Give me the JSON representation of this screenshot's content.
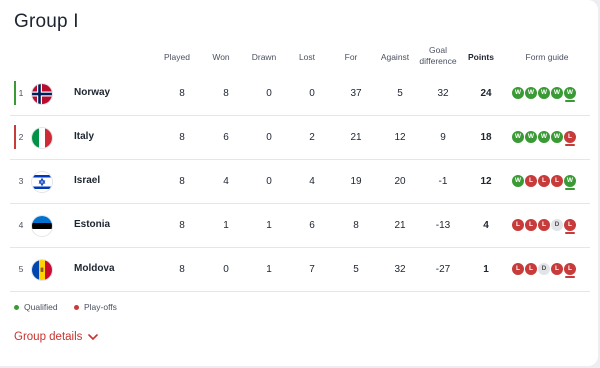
{
  "title": "Group I",
  "headers": {
    "played": "Played",
    "won": "Won",
    "drawn": "Drawn",
    "lost": "Lost",
    "for": "For",
    "against": "Against",
    "goal_diff_1": "Goal",
    "goal_diff_2": "difference",
    "points": "Points",
    "form": "Form guide"
  },
  "rows": [
    {
      "rank": "1",
      "team": "Norway",
      "played": "8",
      "won": "8",
      "drawn": "0",
      "lost": "0",
      "for": "37",
      "against": "5",
      "diff": "32",
      "points": "24",
      "status": "qualified",
      "flag": "norway-flag-icon",
      "form": [
        "W",
        "W",
        "W",
        "W",
        "W"
      ]
    },
    {
      "rank": "2",
      "team": "Italy",
      "played": "8",
      "won": "6",
      "drawn": "0",
      "lost": "2",
      "for": "21",
      "against": "12",
      "diff": "9",
      "points": "18",
      "status": "play-offs",
      "flag": "italy-flag-icon",
      "form": [
        "W",
        "W",
        "W",
        "W",
        "L"
      ]
    },
    {
      "rank": "3",
      "team": "Israel",
      "played": "8",
      "won": "4",
      "drawn": "0",
      "lost": "4",
      "for": "19",
      "against": "20",
      "diff": "-1",
      "points": "12",
      "status": "",
      "flag": "israel-flag-icon",
      "form": [
        "W",
        "L",
        "L",
        "L",
        "W"
      ]
    },
    {
      "rank": "4",
      "team": "Estonia",
      "played": "8",
      "won": "1",
      "drawn": "1",
      "lost": "6",
      "for": "8",
      "against": "21",
      "diff": "-13",
      "points": "4",
      "status": "",
      "flag": "estonia-flag-icon",
      "form": [
        "L",
        "L",
        "L",
        "D",
        "L"
      ]
    },
    {
      "rank": "5",
      "team": "Moldova",
      "played": "8",
      "won": "0",
      "drawn": "1",
      "lost": "7",
      "for": "5",
      "against": "32",
      "diff": "-27",
      "points": "1",
      "status": "",
      "flag": "moldova-flag-icon",
      "form": [
        "L",
        "L",
        "D",
        "L",
        "L"
      ]
    }
  ],
  "legend": {
    "qualified": "Qualified",
    "playoffs": "Play-offs"
  },
  "colors": {
    "qualified": "#3a9a35",
    "playoffs": "#c73b3b",
    "win": "#3a9a35",
    "loss": "#c73b3b",
    "draw": "#e2e4e8",
    "accent": "#c8322f"
  },
  "details_link": "Group details"
}
